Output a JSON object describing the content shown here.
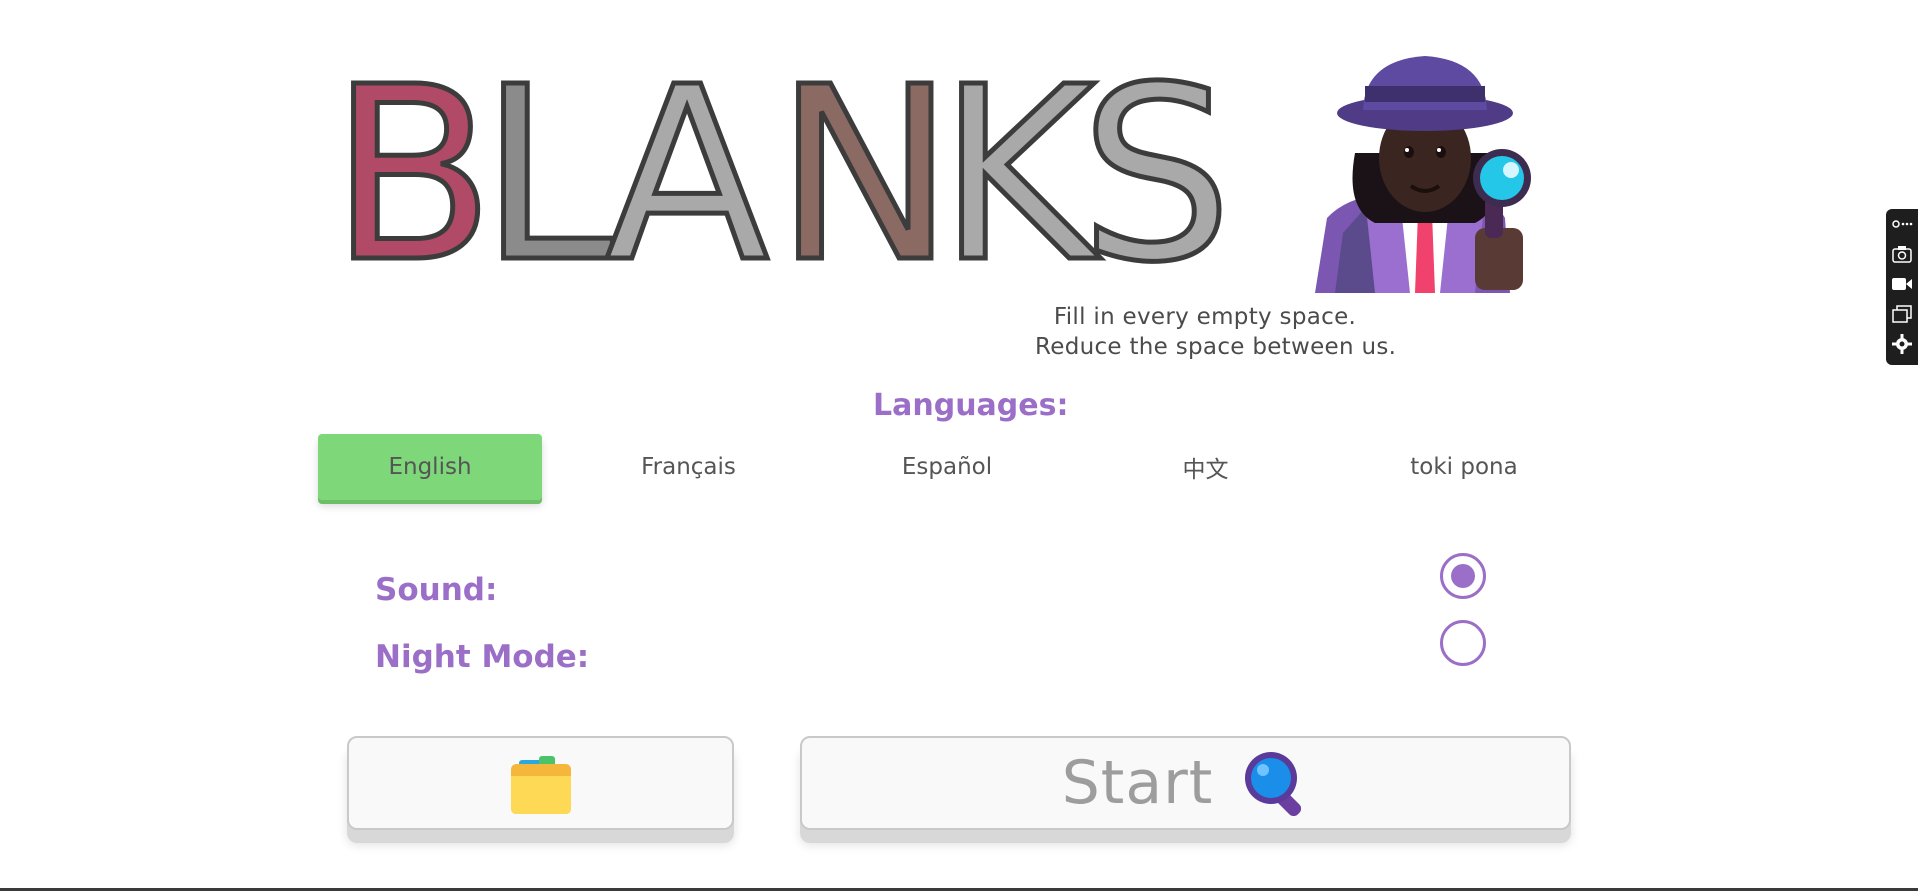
{
  "title": {
    "letters": [
      "B",
      "L",
      "A",
      "N",
      "K",
      "S"
    ],
    "detective_icon": "detective-woman-icon"
  },
  "tagline": {
    "line1": "Fill in every empty space.",
    "line2": "Reduce the space between us."
  },
  "languages": {
    "label": "Languages:",
    "options": [
      "English",
      "Français",
      "Español",
      "中文",
      "toki pona"
    ],
    "selected": "English"
  },
  "settings": {
    "sound_label": "Sound:",
    "sound_on": true,
    "night_mode_label": "Night Mode:",
    "night_mode_on": false
  },
  "buttons": {
    "folder_icon": "card-file-box-icon",
    "start_label": "Start",
    "start_icon": "magnifying-glass-icon"
  },
  "side_toolbar": {
    "icons": [
      "link-icon",
      "camera-icon",
      "video-camera-icon",
      "window-icon",
      "gear-icon"
    ]
  },
  "colors": {
    "accent_purple": "#9b6fc7",
    "selected_language_green": "#7ed87a",
    "letter_gray": "#a9a9a9"
  }
}
